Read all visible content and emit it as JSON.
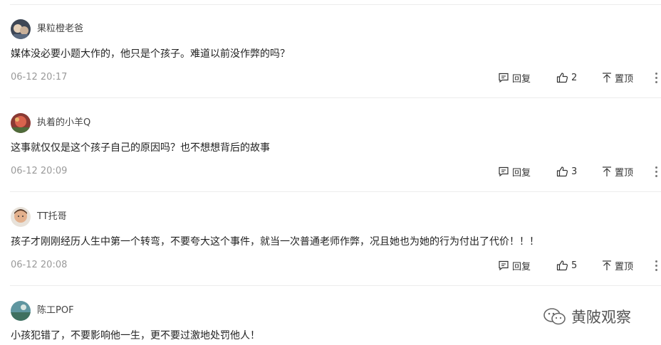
{
  "labels": {
    "reply": "回复",
    "pin": "置顶"
  },
  "comments": [
    {
      "user": "果粒橙老爸",
      "text": "媒体没必要小题大作的，他只是个孩子。难道以前没作弊的吗？",
      "time": "06-12 20:17",
      "likes": "2",
      "avatar_color": "#4a5566"
    },
    {
      "user": "执着的小羊Q",
      "text": "这事就仅仅是这个孩子自己的原因吗？也不想想背后的故事",
      "time": "06-12 20:09",
      "likes": "3",
      "avatar_color": "#c0463c"
    },
    {
      "user": "TT托哥",
      "text": "孩子才刚刚经历人生中第一个转弯，不要夸大这个事件，就当一次普通老师作弊，况且她也为她的行为付出了代价！！！",
      "time": "06-12 20:08",
      "likes": "5",
      "avatar_color": "#d9a37a"
    },
    {
      "user": "陈工POF",
      "text": "小孩犯错了，不要影响他一生，更不要过激地处罚他人！",
      "avatar_color": "#4f8a8c"
    }
  ],
  "watermark": {
    "text": "黄陂观察"
  }
}
